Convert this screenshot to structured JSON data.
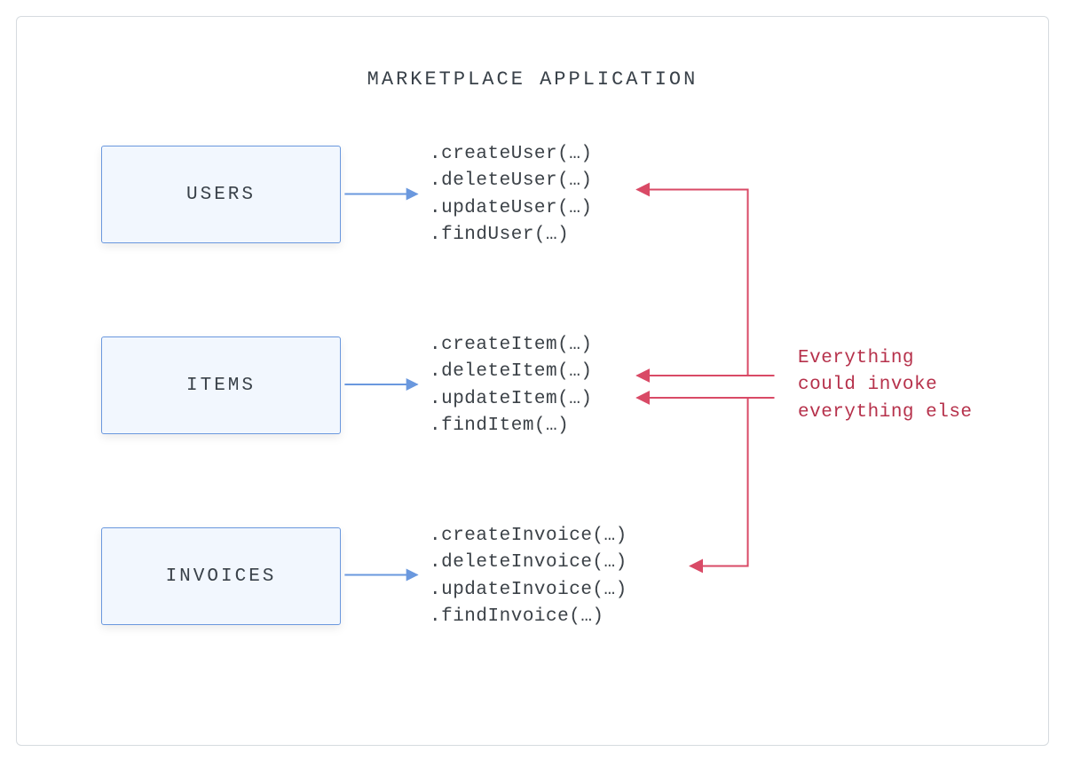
{
  "title": "MARKETPLACE APPLICATION",
  "modules": [
    {
      "label": "USERS",
      "methods": [
        ".createUser(…)",
        ".deleteUser(…)",
        ".updateUser(…)",
        ".findUser(…)"
      ]
    },
    {
      "label": "ITEMS",
      "methods": [
        ".createItem(…)",
        ".deleteItem(…)",
        ".updateItem(…)",
        ".findItem(…)"
      ]
    },
    {
      "label": "INVOICES",
      "methods": [
        ".createInvoice(…)",
        ".deleteInvoice(…)",
        ".updateInvoice(…)",
        ".findInvoice(…)"
      ]
    }
  ],
  "annotation": {
    "line1": "Everything",
    "line2": "could invoke",
    "line3": "everything else"
  },
  "colors": {
    "module_bg": "#f2f7fe",
    "module_border": "#6a98de",
    "arrow_blue": "#6a98de",
    "arrow_red": "#d94a66",
    "text_red": "#b6314b",
    "text_gray": "#394149"
  }
}
